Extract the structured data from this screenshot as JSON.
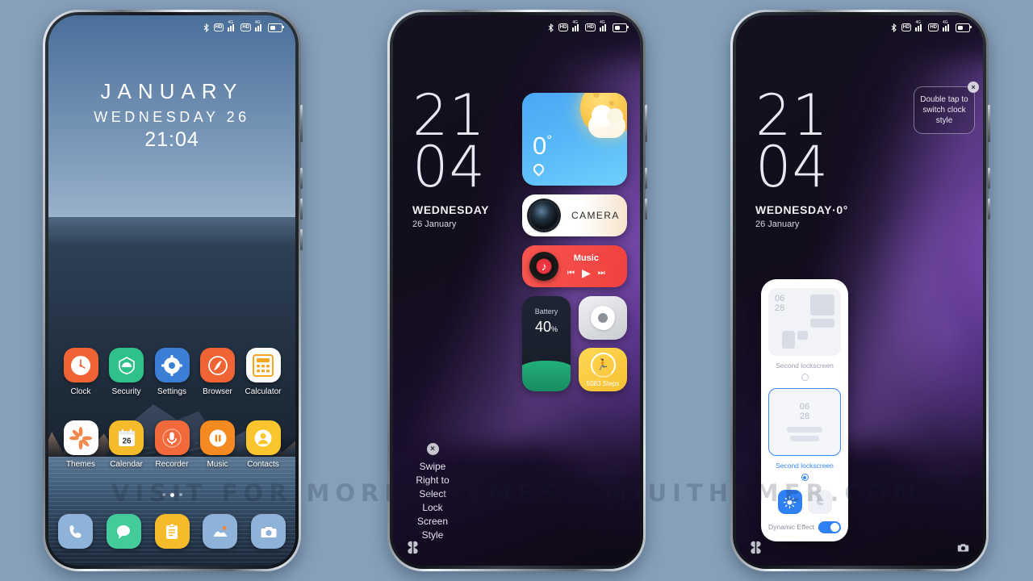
{
  "background_color": "#86a0bc",
  "watermark": "VISIT FOR MORE THEMES  -  MIUITHEMER.COM",
  "statusbar": {
    "bluetooth": "bluetooth-icon",
    "hd": "HD",
    "network": "4G",
    "battery": "battery-icon"
  },
  "phone1": {
    "name": "home-screen",
    "clock": {
      "month": "JANUARY",
      "weekday_date": "WEDNESDAY 26",
      "time": "21:04"
    },
    "apps_row1": [
      {
        "label": "Clock",
        "icon": "clock-icon",
        "color": "#ef6335"
      },
      {
        "label": "Security",
        "icon": "shield-icon",
        "color": "#2ec18a"
      },
      {
        "label": "Settings",
        "icon": "gear-icon",
        "color": "#3a7fd5"
      },
      {
        "label": "Browser",
        "icon": "compass-icon",
        "color": "#ef6335"
      },
      {
        "label": "Calculator",
        "icon": "calculator-icon",
        "color": "#fdfdfd"
      }
    ],
    "apps_row2": [
      {
        "label": "Themes",
        "icon": "flower-icon",
        "color": "#fdfdfd"
      },
      {
        "label": "Calendar",
        "icon": "calendar-icon",
        "color": "#f6bb2a",
        "date": "26"
      },
      {
        "label": "Recorder",
        "icon": "microphone-icon",
        "color": "#f2693c"
      },
      {
        "label": "Music",
        "icon": "pause-icon",
        "color": "#f58a21"
      },
      {
        "label": "Contacts",
        "icon": "person-icon",
        "color": "#fbc52d"
      }
    ],
    "dock": [
      {
        "label": "Phone",
        "icon": "phone-icon",
        "color": "#8fb2d8"
      },
      {
        "label": "Messages",
        "icon": "message-icon",
        "color": "#43cc9a"
      },
      {
        "label": "Notes",
        "icon": "notes-icon",
        "color": "#f6bb2a"
      },
      {
        "label": "Gallery",
        "icon": "gallery-icon",
        "color": "#8fb2d8"
      },
      {
        "label": "Camera",
        "icon": "camera-icon",
        "color": "#8fb2d8"
      }
    ],
    "page_dots": 3,
    "active_dot": 2
  },
  "phone2": {
    "name": "lockscreen-widgets",
    "clock": {
      "hours": "21",
      "minutes": "04",
      "weekday": "WEDNESDAY",
      "date": "26 January"
    },
    "widgets": {
      "weather": {
        "temperature": "0",
        "degree": "°",
        "icon": "sun-cloud-icon",
        "location_icon": "pin-icon"
      },
      "camera": {
        "label": "CAMERA",
        "icon": "camera-lens-icon"
      },
      "music": {
        "title": "Music",
        "prev": "⏮",
        "play": "▶",
        "next": "⏭",
        "icon": "music-note-icon"
      },
      "battery": {
        "label": "Battery",
        "value": "40",
        "unit": "%"
      },
      "recorder": {
        "icon": "recorder-blob-icon"
      },
      "steps": {
        "value": "5083 Steps",
        "icon": "running-icon"
      }
    },
    "hint": {
      "close": "×",
      "text": "Swipe Right to Select Lock Screen Style"
    },
    "nav": {
      "left_icon": "clover-icon"
    }
  },
  "phone3": {
    "name": "lockscreen-style-picker",
    "clock": {
      "hours": "21",
      "minutes": "04",
      "weekday_temp": "WEDNESDAY·0°",
      "date": "26 January"
    },
    "hint": {
      "close": "×",
      "text": "Double tap to switch clock style"
    },
    "picker": {
      "options": [
        {
          "label": "Second lockscreen",
          "preview_time": "06\n28",
          "selected": false
        },
        {
          "label": "Second lockscreen",
          "preview_time": "06\n28",
          "selected": true
        }
      ],
      "modes": [
        {
          "icon": "sun-icon",
          "active": true
        },
        {
          "icon": "moon-icon",
          "active": false
        }
      ],
      "dynamic_effect": {
        "label": "Dynamic Effect",
        "enabled": true
      },
      "accent_color": "#3a86f7"
    },
    "nav": {
      "left_icon": "clover-icon",
      "right_icon": "camera-icon"
    }
  }
}
